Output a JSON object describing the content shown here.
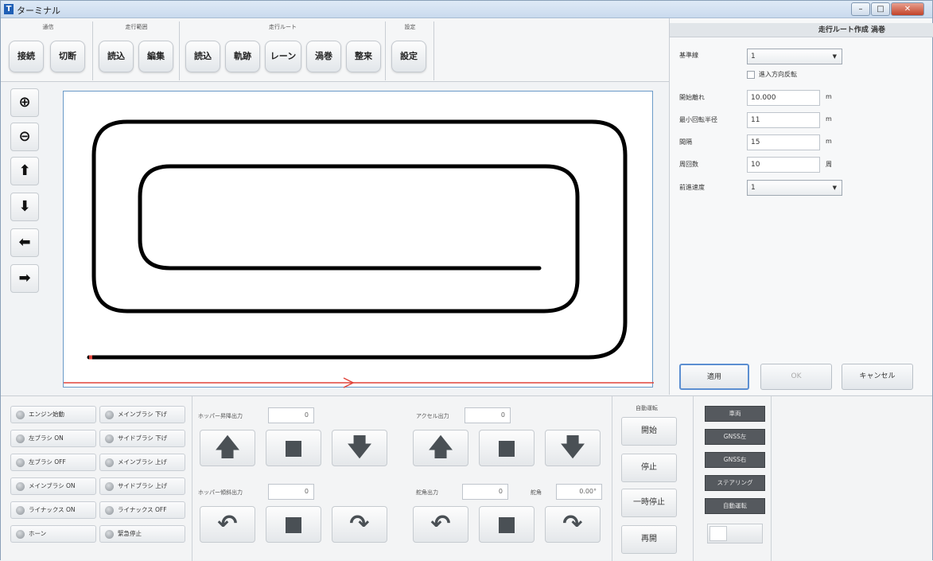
{
  "window": {
    "title": "ターミナル",
    "minimize": "–",
    "maximize": "□",
    "close": "✕"
  },
  "toolbar": {
    "groups": [
      {
        "label": "通信",
        "buttons": [
          "接続",
          "切断"
        ]
      },
      {
        "label": "走行範囲",
        "buttons": [
          "読込",
          "編集"
        ]
      },
      {
        "label": "走行ルート",
        "buttons": [
          "読込",
          "軌跡",
          "レーン",
          "渦巻",
          "整来"
        ]
      },
      {
        "label": "設定",
        "buttons": [
          "設定"
        ]
      }
    ]
  },
  "sidebar": {
    "icons": [
      "zoom-in-icon",
      "zoom-out-icon",
      "arrow-up-icon",
      "arrow-down-icon",
      "arrow-left-icon",
      "arrow-right-icon"
    ]
  },
  "canvas": {
    "route": "spiral",
    "route_color": "#000000",
    "entry_color": "#e0443a",
    "border_color": "#6a9ac8"
  },
  "panel": {
    "title": "走行ルート作成 渦巻",
    "base_line_label": "基準線",
    "base_line_value": "1",
    "reverse_label": "進入方向反転",
    "start_distance_label": "開始離れ",
    "start_distance_value": "10.000",
    "start_distance_unit": "m",
    "min_radius_label": "最小回転半径",
    "min_radius_value": "11",
    "min_radius_unit": "m",
    "spacing_label": "間隔",
    "spacing_value": "15",
    "spacing_unit": "m",
    "turns_label": "周回数",
    "turns_value": "10",
    "turns_unit": "周",
    "direction_label": "前進速度",
    "direction_value": "1",
    "apply": "適用",
    "ok": "OK",
    "cancel": "キャンセル"
  },
  "status_buttons": [
    "エンジン始動",
    "メインブラシ 下げ",
    "左ブラシ ON",
    "サイドブラシ 下げ",
    "左ブラシ OFF",
    "メインブラシ 上げ",
    "メインブラシ ON",
    "サイドブラシ 上げ",
    "ライナックス ON",
    "ライナックス OFF",
    "ホーン",
    "緊急停止"
  ],
  "controls": {
    "hopper_lift_label": "ホッパー昇降出力",
    "hopper_lift_value": "0",
    "hopper_tilt_label": "ホッパー傾斜出力",
    "hopper_tilt_value": "0",
    "accel_label": "アクセル出力",
    "accel_value": "0",
    "steer_label": "舵角出力",
    "steer_value": "0",
    "steer_angle_label": "舵角",
    "steer_angle_value": "0.00°"
  },
  "auto": {
    "label": "自動運転",
    "start": "開始",
    "stop": "停止",
    "pause": "一時停止",
    "resume": "再開"
  },
  "modes": [
    "車両",
    "GNSS左",
    "GNSS右",
    "ステアリング",
    "自動運転"
  ]
}
